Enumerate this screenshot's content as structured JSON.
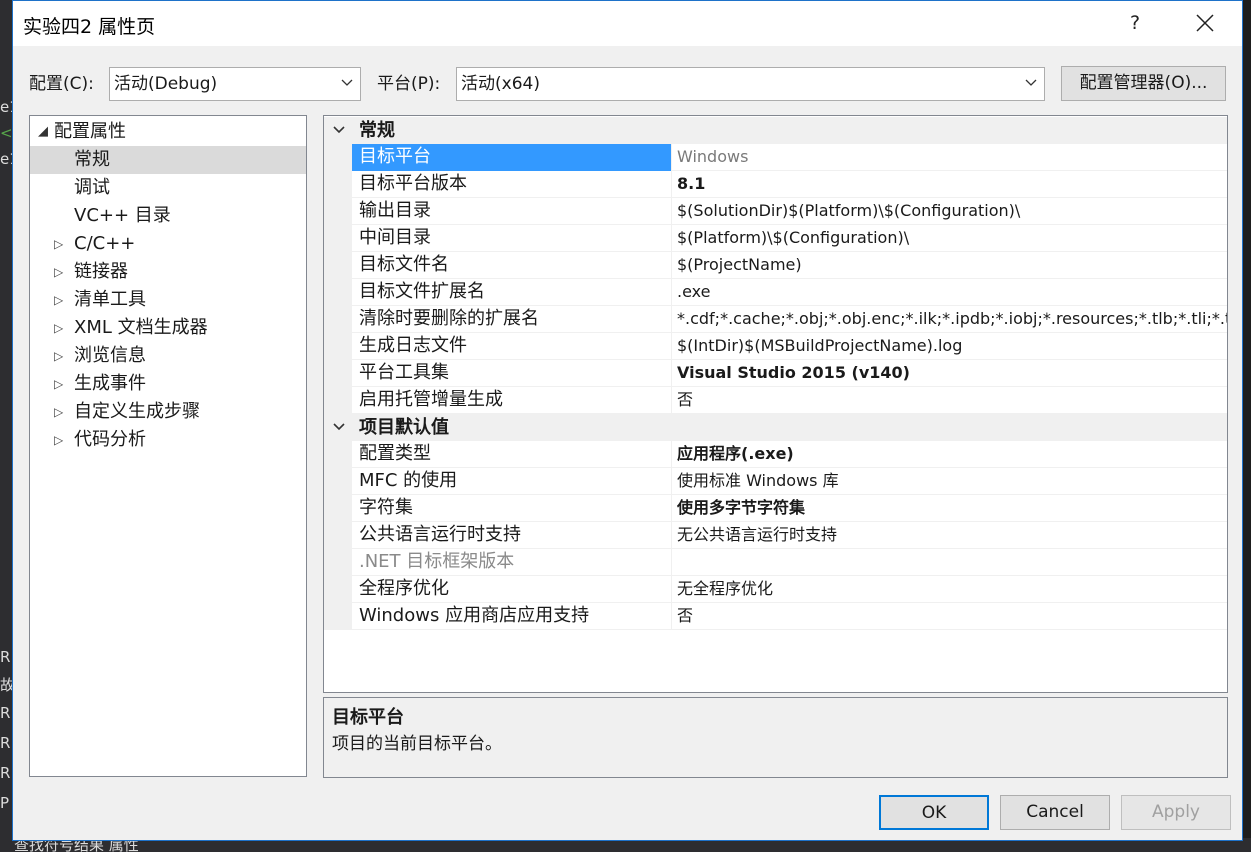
{
  "window": {
    "title": "实验四2 属性页",
    "help": "?",
    "close": "✕"
  },
  "toolbar": {
    "config_label": "配置(C):",
    "config_value": "活动(Debug)",
    "platform_label": "平台(P):",
    "platform_value": "活动(x64)",
    "config_manager": "配置管理器(O)..."
  },
  "tree": {
    "root": "配置属性",
    "items": [
      {
        "label": "常规",
        "selected": true,
        "expandable": false
      },
      {
        "label": "调试",
        "selected": false,
        "expandable": false
      },
      {
        "label": "VC++ 目录",
        "selected": false,
        "expandable": false
      },
      {
        "label": "C/C++",
        "selected": false,
        "expandable": true
      },
      {
        "label": "链接器",
        "selected": false,
        "expandable": true
      },
      {
        "label": "清单工具",
        "selected": false,
        "expandable": true
      },
      {
        "label": "XML 文档生成器",
        "selected": false,
        "expandable": true
      },
      {
        "label": "浏览信息",
        "selected": false,
        "expandable": true
      },
      {
        "label": "生成事件",
        "selected": false,
        "expandable": true
      },
      {
        "label": "自定义生成步骤",
        "selected": false,
        "expandable": true
      },
      {
        "label": "代码分析",
        "selected": false,
        "expandable": true
      }
    ]
  },
  "grid": {
    "categories": [
      {
        "label": "常规",
        "rows": [
          {
            "name": "目标平台",
            "value": "Windows",
            "style": "grey",
            "selected": true
          },
          {
            "name": "目标平台版本",
            "value": "8.1",
            "style": "bold"
          },
          {
            "name": "输出目录",
            "value": "$(SolutionDir)$(Platform)\\$(Configuration)\\",
            "style": ""
          },
          {
            "name": "中间目录",
            "value": "$(Platform)\\$(Configuration)\\",
            "style": ""
          },
          {
            "name": "目标文件名",
            "value": "$(ProjectName)",
            "style": ""
          },
          {
            "name": "目标文件扩展名",
            "value": ".exe",
            "style": ""
          },
          {
            "name": "清除时要删除的扩展名",
            "value": "*.cdf;*.cache;*.obj;*.obj.enc;*.ilk;*.ipdb;*.iobj;*.resources;*.tlb;*.tli;*.tlh;*",
            "style": ""
          },
          {
            "name": "生成日志文件",
            "value": "$(IntDir)$(MSBuildProjectName).log",
            "style": ""
          },
          {
            "name": "平台工具集",
            "value": "Visual Studio 2015 (v140)",
            "style": "bold"
          },
          {
            "name": "启用托管增量生成",
            "value": "否",
            "style": ""
          }
        ]
      },
      {
        "label": "项目默认值",
        "rows": [
          {
            "name": "配置类型",
            "value": "应用程序(.exe)",
            "style": "bold"
          },
          {
            "name": "MFC 的使用",
            "value": "使用标准 Windows 库",
            "style": ""
          },
          {
            "name": "字符集",
            "value": "使用多字节字符集",
            "style": "bold"
          },
          {
            "name": "公共语言运行时支持",
            "value": "无公共语言运行时支持",
            "style": ""
          },
          {
            "name": ".NET 目标框架版本",
            "value": "",
            "style": "",
            "disabled": true
          },
          {
            "name": "全程序优化",
            "value": "无全程序优化",
            "style": ""
          },
          {
            "name": "Windows 应用商店应用支持",
            "value": "否",
            "style": ""
          }
        ]
      }
    ]
  },
  "description": {
    "title": "目标平台",
    "text": "项目的当前目标平台。"
  },
  "buttons": {
    "ok": "OK",
    "cancel": "Cancel",
    "apply": "Apply"
  },
  "background": {
    "left_fragments": [
      "e1",
      "<",
      "e1",
      "",
      "R",
      "故",
      "R",
      "R",
      "R",
      "P"
    ],
    "status": "查找符号结果  属性"
  },
  "colors": {
    "accent": "#0078d7",
    "selection": "#3399ff",
    "dialog_bg": "#f0f0f0"
  }
}
